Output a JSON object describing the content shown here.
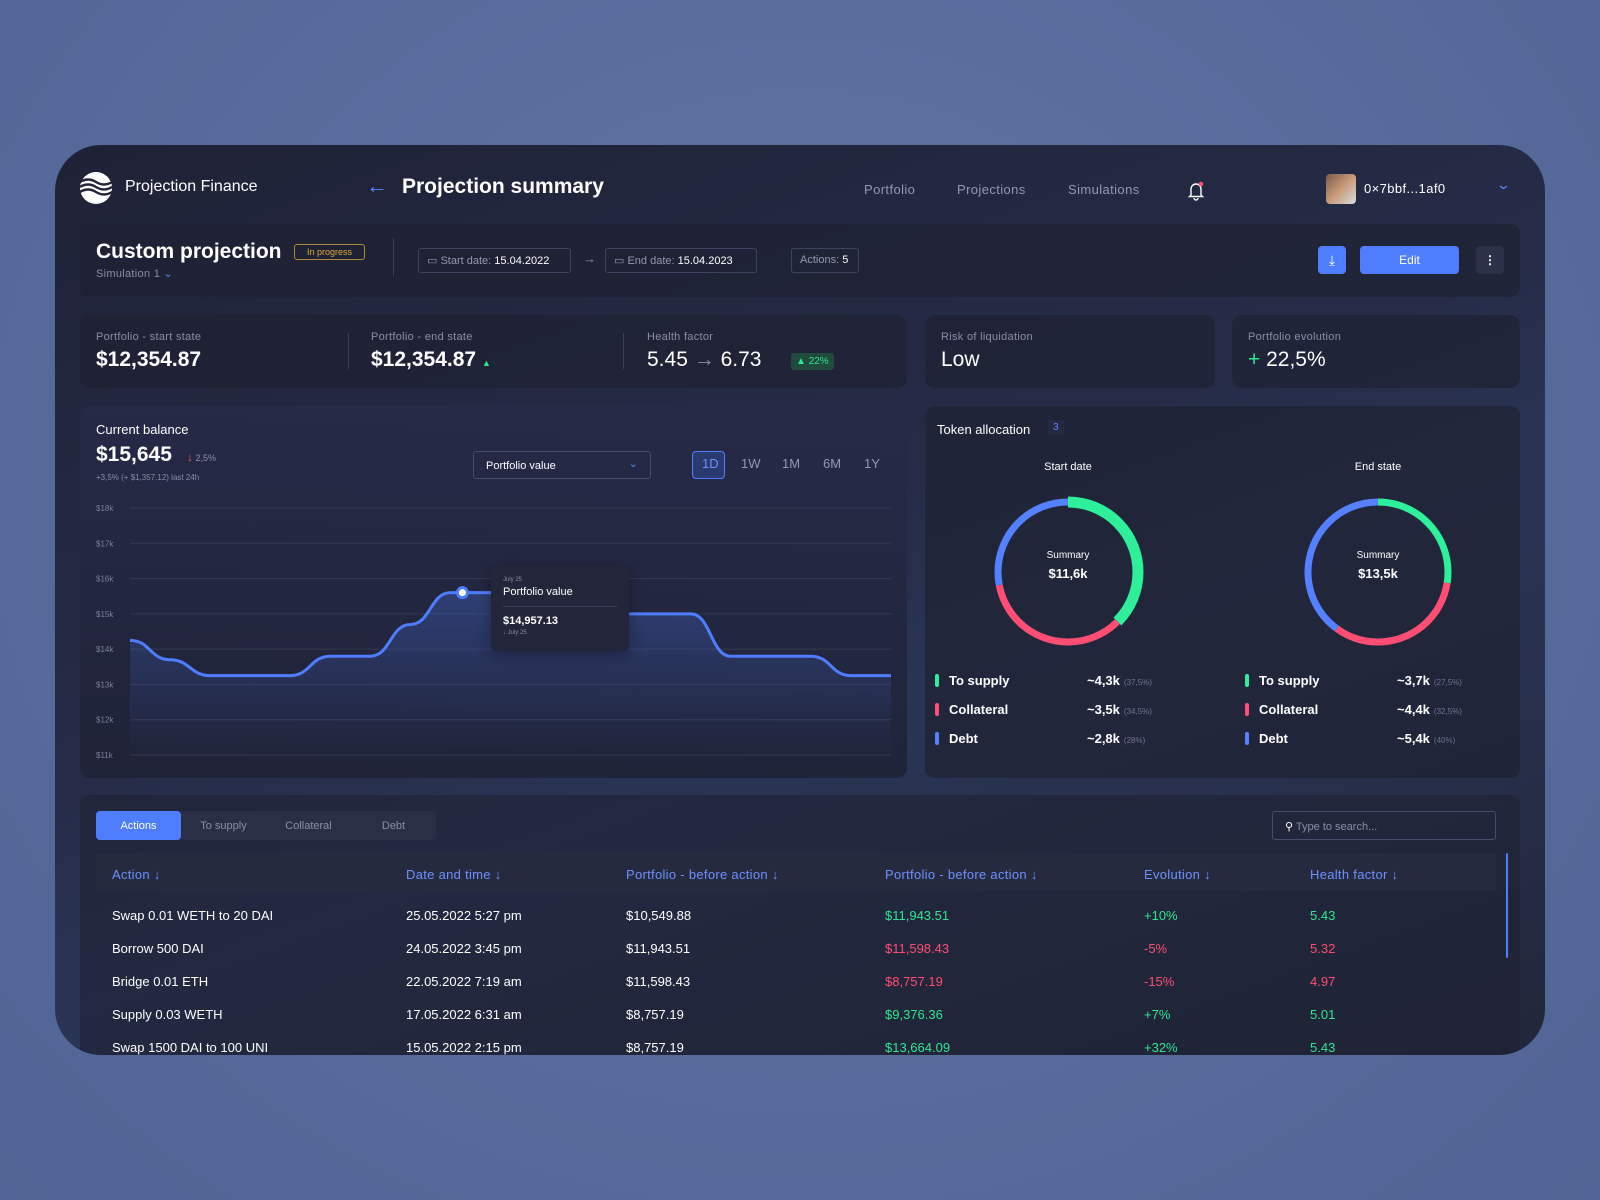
{
  "brand": {
    "name": "Projection Finance"
  },
  "header": {
    "title": "Projection summary",
    "nav": [
      "Portfolio",
      "Projections",
      "Simulations"
    ],
    "wallet": "0×7bbf...1af0",
    "notification_dot": true
  },
  "projection": {
    "title": "Custom projection",
    "status": "In progress",
    "simulation": "Simulation 1",
    "start_label": "Start date:",
    "start_date": "15.04.2022",
    "end_label": "End date:",
    "end_date": "15.04.2023",
    "actions_label": "Actions:",
    "actions_count": "5",
    "edit": "Edit"
  },
  "stats": {
    "start_label": "Portfolio - start state",
    "start_value": "$12,354.87",
    "end_label": "Portfolio - end state",
    "end_value": "$12,354.87",
    "health_label": "Health factor",
    "health_from": "5.45",
    "health_to": "6.73",
    "health_change": "22%",
    "risk_label": "Risk of liquidation",
    "risk_value": "Low",
    "evo_label": "Portfolio evolution",
    "evo_sign": "+",
    "evo_value": "22,5%"
  },
  "balance": {
    "title": "Current balance",
    "value": "$15,645",
    "change": "2,5%",
    "sub": "+3,5% (+ $1,357.12) last 24h",
    "select": "Portfolio value",
    "timeframes": [
      "1D",
      "1W",
      "1M",
      "6M",
      "1Y"
    ],
    "active_timeframe": "1D"
  },
  "tooltip": {
    "date": "July 25",
    "title": "Portfolio value",
    "value": "$14,957.13",
    "sub": "July 25"
  },
  "chart_data": {
    "type": "area",
    "ylim": [
      11000,
      18000
    ],
    "y_ticks": [
      "$18k",
      "$17k",
      "$16k",
      "$15k",
      "$14k",
      "$13k",
      "$12k",
      "$11k"
    ],
    "grid": true,
    "color": "#4f7dff",
    "values": [
      14250,
      13700,
      13250,
      13250,
      13250,
      13800,
      13800,
      14700,
      15600,
      15600,
      15000,
      15000,
      15000,
      15000,
      15000,
      13800,
      13800,
      13800,
      13250,
      13250
    ],
    "highlight_index": 8
  },
  "tokens": {
    "title": "Token allocation",
    "count": "3",
    "colors": {
      "supply": "#2ef09a",
      "collateral": "#ff4d73",
      "debt": "#5580ff"
    },
    "donuts": [
      {
        "title": "Start date",
        "summary_label": "Summary",
        "summary": "$11,6k",
        "items": [
          {
            "label": "To supply",
            "value": "~4,3k",
            "pct": "(37,5%)",
            "share": 37.5
          },
          {
            "label": "Collateral",
            "value": "~3,5k",
            "pct": "(34,5%)",
            "share": 34.5
          },
          {
            "label": "Debt",
            "value": "~2,8k",
            "pct": "(28%)",
            "share": 28
          }
        ]
      },
      {
        "title": "End state",
        "summary_label": "Summary",
        "summary": "$13,5k",
        "items": [
          {
            "label": "To supply",
            "value": "~3,7k",
            "pct": "(27,5%)",
            "share": 27.5
          },
          {
            "label": "Collateral",
            "value": "~4,4k",
            "pct": "(32,5%)",
            "share": 32.5
          },
          {
            "label": "Debt",
            "value": "~5,4k",
            "pct": "(40%)",
            "share": 40
          }
        ]
      }
    ]
  },
  "table": {
    "tabs": [
      "Actions",
      "To supply",
      "Collateral",
      "Debt"
    ],
    "search_placeholder": "Type to search...",
    "columns": [
      "Action",
      "Date and time",
      "Portfolio - before action",
      "Portfolio - before action",
      "Evolution",
      "Health factor"
    ],
    "rows": [
      {
        "action": "Swap 0.01 WETH to 20 DAI",
        "date": "25.05.2022 5:27 pm",
        "before": "$10,549.88",
        "after": "$11,943.51",
        "evo": "+10%",
        "hf": "5.43",
        "trend": "up"
      },
      {
        "action": "Borrow 500 DAI",
        "date": "24.05.2022 3:45 pm",
        "before": "$11,943.51",
        "after": "$11,598.43",
        "evo": "-5%",
        "hf": "5.32",
        "trend": "down"
      },
      {
        "action": "Bridge 0.01 ETH",
        "date": "22.05.2022 7:19 am",
        "before": "$11,598.43",
        "after": "$8,757.19",
        "evo": "-15%",
        "hf": "4.97",
        "trend": "down"
      },
      {
        "action": "Supply 0.03 WETH",
        "date": "17.05.2022 6:31 am",
        "before": "$8,757.19",
        "after": "$9,376.36",
        "evo": "+7%",
        "hf": "5.01",
        "trend": "up"
      },
      {
        "action": "Swap 1500 DAI to 100 UNI",
        "date": "15.05.2022 2:15 pm",
        "before": "$8,757.19",
        "after": "$13,664.09",
        "evo": "+32%",
        "hf": "5.43",
        "trend": "up"
      }
    ]
  }
}
